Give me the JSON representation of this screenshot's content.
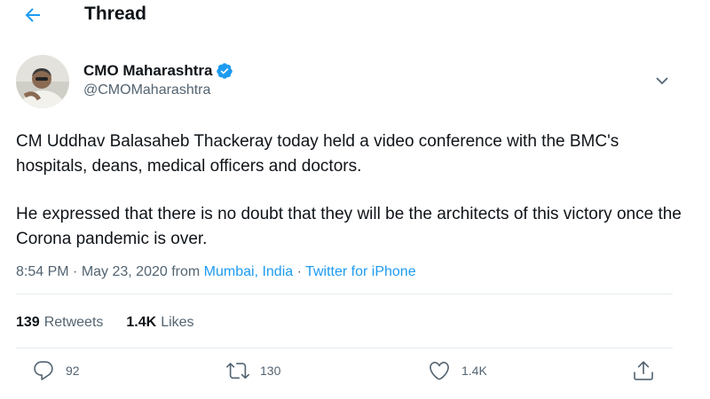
{
  "header": {
    "title": "Thread"
  },
  "author": {
    "display_name": "CMO Maharashtra",
    "handle": "@CMOMaharashtra"
  },
  "tweet": {
    "paragraph1": "CM Uddhav Balasaheb Thackeray today held a video conference with the BMC's hospitals, deans, medical officers and doctors.",
    "paragraph2": "He expressed that there is no doubt that they will be the architects of this victory once the Corona pandemic is over."
  },
  "meta": {
    "time": "8:54 PM",
    "sep1": " · ",
    "date": "May 23, 2020",
    "from": " from ",
    "location": "Mumbai, India",
    "sep2": " · ",
    "source": "Twitter for iPhone"
  },
  "stats": {
    "retweets_count": "139",
    "retweets_label": "Retweets",
    "likes_count": "1.4K",
    "likes_label": "Likes"
  },
  "actions": {
    "reply_count": "92",
    "retweet_count": "130",
    "like_count": "1.4K"
  },
  "colors": {
    "accent": "#1d9bf0",
    "text": "#0f1419",
    "secondary": "#536471",
    "divider": "#e6ecf0"
  }
}
